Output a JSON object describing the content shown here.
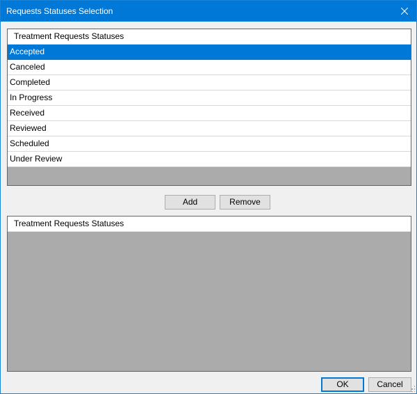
{
  "window": {
    "title": "Requests Statuses Selection",
    "accent_color": "#0078d7",
    "close_icon": "close-icon"
  },
  "available_grid": {
    "header": "Treatment Requests Statuses",
    "rows": [
      {
        "label": "Accepted",
        "selected": true
      },
      {
        "label": "Canceled",
        "selected": false
      },
      {
        "label": "Completed",
        "selected": false
      },
      {
        "label": "In Progress",
        "selected": false
      },
      {
        "label": "Received",
        "selected": false
      },
      {
        "label": "Reviewed",
        "selected": false
      },
      {
        "label": "Scheduled",
        "selected": false
      },
      {
        "label": "Under Review",
        "selected": false
      }
    ]
  },
  "actions": {
    "add_label": "Add",
    "remove_label": "Remove"
  },
  "selected_grid": {
    "header": "Treatment Requests Statuses",
    "rows": []
  },
  "footer": {
    "ok_label": "OK",
    "cancel_label": "Cancel"
  }
}
